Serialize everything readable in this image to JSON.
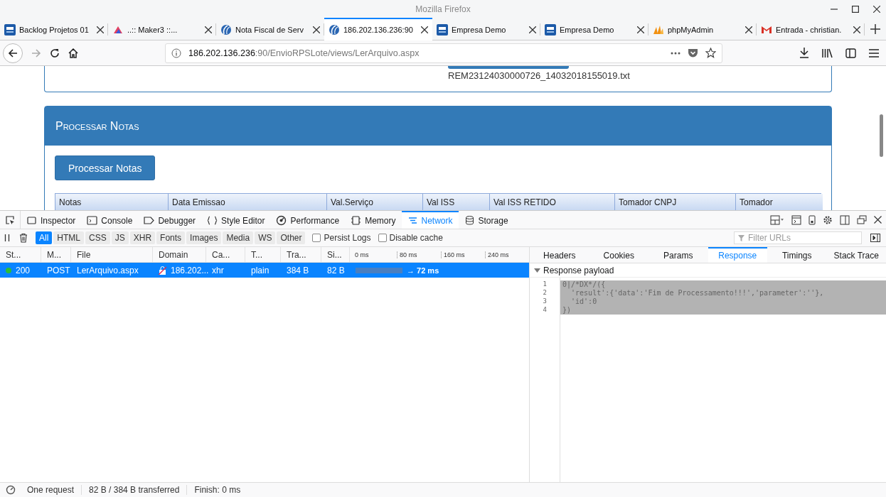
{
  "window": {
    "title": "Mozilla Firefox"
  },
  "tabs": [
    {
      "label": "Backlog Projetos 01",
      "kind": "ixc",
      "selected": false
    },
    {
      "label": "..:: Maker3 ::...",
      "kind": "maker",
      "selected": false
    },
    {
      "label": "Nota Fiscal de Serv",
      "kind": "globe",
      "selected": false
    },
    {
      "label": "186.202.136.236:90",
      "kind": "globe",
      "selected": true
    },
    {
      "label": "Empresa Demo",
      "kind": "ixc",
      "selected": false
    },
    {
      "label": "Empresa Demo",
      "kind": "ixc",
      "selected": false
    },
    {
      "label": "phpMyAdmin",
      "kind": "pma",
      "selected": false
    },
    {
      "label": "Entrada - christian.",
      "kind": "mail",
      "selected": false
    }
  ],
  "navbar": {
    "forward_disabled": true,
    "url_host": "186.202.136.236",
    "url_path": ":90/EnvioRPSLote/views/LerArquivo.aspx"
  },
  "page": {
    "file_name": "REM23124030000726_14032018155019.txt",
    "panel": {
      "title": "Processar Notas",
      "button": "Processar Notas",
      "columns": [
        "Notas",
        "Data Emissao",
        "Val.Serviço",
        "Val ISS",
        "Val ISS RETIDO",
        "Tomador CNPJ",
        "Tomador"
      ]
    }
  },
  "devtools": {
    "tools": [
      {
        "label": "Inspector",
        "kind": "inspector",
        "selected": false
      },
      {
        "label": "Console",
        "kind": "console",
        "selected": false
      },
      {
        "label": "Debugger",
        "kind": "debugger",
        "selected": false
      },
      {
        "label": "Style Editor",
        "kind": "style",
        "selected": false
      },
      {
        "label": "Performance",
        "kind": "performance",
        "selected": false
      },
      {
        "label": "Memory",
        "kind": "memory",
        "selected": false
      },
      {
        "label": "Network",
        "kind": "network",
        "selected": true
      },
      {
        "label": "Storage",
        "kind": "storage",
        "selected": false
      }
    ],
    "filters": [
      {
        "label": "All",
        "selected": true
      },
      {
        "label": "HTML",
        "selected": false
      },
      {
        "label": "CSS",
        "selected": false
      },
      {
        "label": "JS",
        "selected": false
      },
      {
        "label": "XHR",
        "selected": false
      },
      {
        "label": "Fonts",
        "selected": false
      },
      {
        "label": "Images",
        "selected": false
      },
      {
        "label": "Media",
        "selected": false
      },
      {
        "label": "WS",
        "selected": false
      },
      {
        "label": "Other",
        "selected": false
      }
    ],
    "options": [
      {
        "label": "Persist Logs",
        "checked": false
      },
      {
        "label": "Disable cache",
        "checked": false
      }
    ],
    "filter_placeholder": "Filter URLs",
    "columns": [
      "St...",
      "M...",
      "File",
      "Domain",
      "Ca...",
      "T...",
      "Tra...",
      "Si..."
    ],
    "timeline_ticks": [
      "0 ms",
      "80 ms",
      "160 ms",
      "240 ms"
    ],
    "requests": [
      {
        "status": "200",
        "method": "POST",
        "file": "LerArquivo.aspx",
        "domain": "186.202...",
        "cause": "xhr",
        "type": "plain",
        "transferred": "384 B",
        "size": "82 B",
        "time": "→ 72 ms",
        "selected": true
      }
    ],
    "detail_tabs": [
      {
        "label": "Headers",
        "selected": false
      },
      {
        "label": "Cookies",
        "selected": false
      },
      {
        "label": "Params",
        "selected": false
      },
      {
        "label": "Response",
        "selected": true
      },
      {
        "label": "Timings",
        "selected": false
      },
      {
        "label": "Stack Trace",
        "selected": false
      }
    ],
    "payload_title": "Response payload",
    "code": [
      {
        "number": "1",
        "text": "0|/*DX*/({",
        "selected": true
      },
      {
        "number": "2",
        "text": "  'result':{'data':'Fim de Processamento!!!','parameter':''},",
        "selected": true
      },
      {
        "number": "3",
        "text": "  'id':0",
        "selected": true
      },
      {
        "number": "4",
        "text": "})",
        "selected": true
      }
    ],
    "status_bar": [
      "One request",
      "82 B / 384 B transferred",
      "Finish: 0 ms"
    ]
  }
}
